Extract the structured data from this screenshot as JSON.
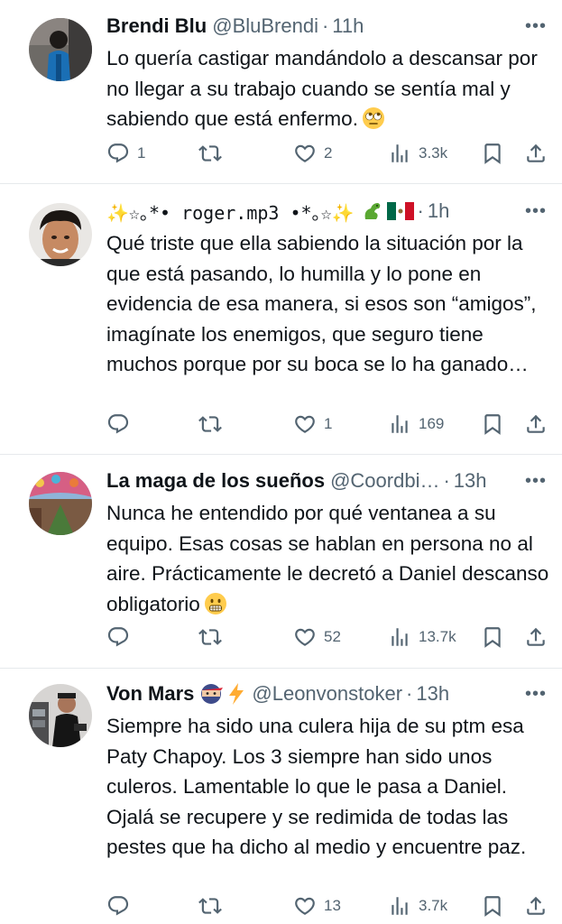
{
  "colors": {
    "text": "#0f1419",
    "muted": "#536471",
    "divider": "#e6e9ec",
    "flag_green": "#006847",
    "flag_red": "#ce1126"
  },
  "tweets": [
    {
      "name": "Brendi Blu",
      "handle": "@BluBrendi",
      "time": "11h",
      "text": "Lo quería castigar mandándolo a descansar por no llegar a su trabajo cuando se sentía mal y sabiendo que está enfermo.",
      "emoji_icon": "rolling-eyes-emoji",
      "replies": "1",
      "reposts": "",
      "likes": "2",
      "views": "3.3k"
    },
    {
      "name_prefix": "✨☆｡*•",
      "name": "roger.mp3",
      "name_suffix": "•*｡☆✨",
      "name_icons": [
        "dragon-emoji",
        "mexico-flag-emoji"
      ],
      "handle": "",
      "time": "1h",
      "text": "Qué triste que ella sabiendo la situación por la que está pasando, lo humilla y lo pone en evidencia de esa manera, si esos son “amigos”, imagínate los enemigos, que seguro tiene muchos porque por su boca se lo ha ganado…",
      "replies": "",
      "reposts": "",
      "likes": "1",
      "views": "169"
    },
    {
      "name": "La maga de los sueños",
      "handle": "@Coordbi…",
      "time": "13h",
      "text": "Nunca he entendido por qué ventanea a su equipo. Esas cosas se hablan en persona no al aire. Prácticamente le decretó a Daniel descanso obligatorio",
      "emoji_icon": "grimacing-emoji",
      "replies": "",
      "reposts": "",
      "likes": "52",
      "views": "13.7k"
    },
    {
      "name": "Von Mars",
      "name_icons": [
        "ninja-emoji",
        "lightning-emoji"
      ],
      "handle": "@Leonvonstoker",
      "time": "13h",
      "text": "Siempre ha sido una culera hija de su ptm esa Paty Chapoy. Los 3 siempre han sido unos culeros. Lamentable lo que le pasa a Daniel. Ojalá se recupere y se redimida de todas las pestes que ha dicho al medio y encuentre paz.",
      "replies": "",
      "reposts": "",
      "likes": "13",
      "views": "3.7k"
    }
  ]
}
